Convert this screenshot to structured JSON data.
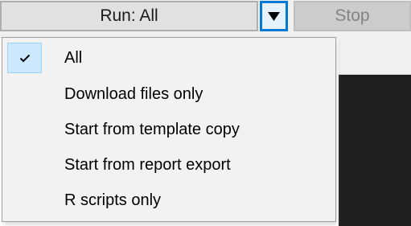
{
  "toolbar": {
    "run_label": "Run: All",
    "stop_label": "Stop",
    "dropdown_arrow_icon": "triangle-down-icon"
  },
  "run_menu": {
    "selected": "All",
    "check_icon": "checkmark-icon",
    "items": [
      {
        "label": "All",
        "checked": true
      },
      {
        "label": "Download files only",
        "checked": false
      },
      {
        "label": "Start from template copy",
        "checked": false
      },
      {
        "label": "Start from report export",
        "checked": false
      },
      {
        "label": "R scripts only",
        "checked": false
      }
    ]
  },
  "colors": {
    "accent": "#0078d7",
    "checked_highlight": "#cce8ff",
    "console_background": "#1e1e1e",
    "disabled_text": "#838383"
  }
}
